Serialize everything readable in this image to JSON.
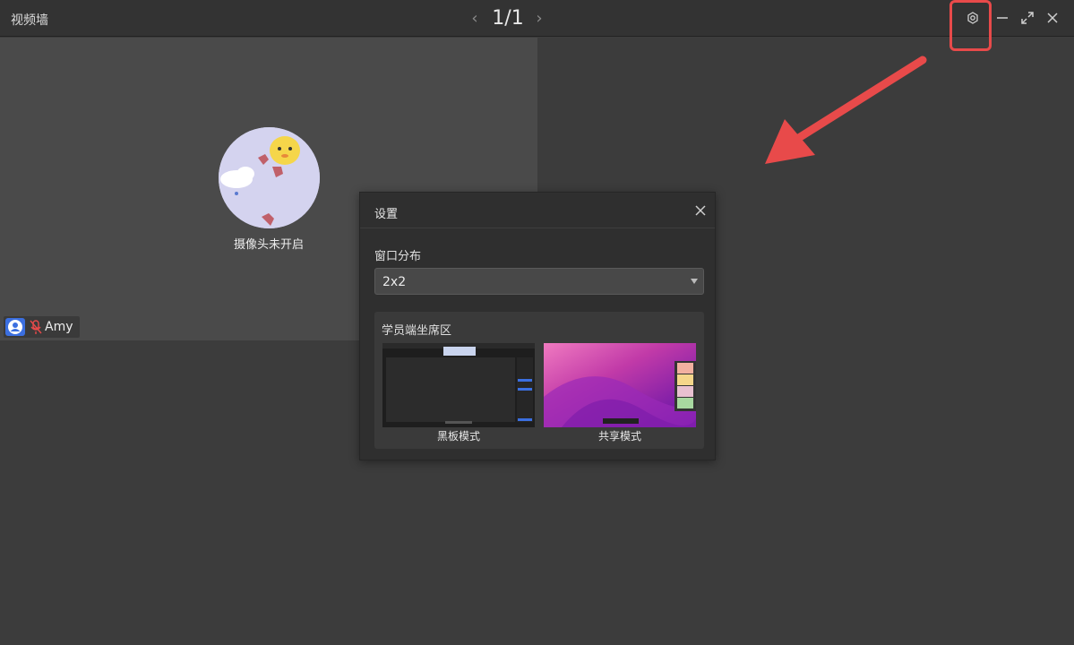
{
  "window": {
    "title": "视频墙",
    "page_indicator": "1/1"
  },
  "toolbar": {
    "icons": [
      "chevron-left-icon",
      "chevron-right-icon",
      "settings-hexagon-icon",
      "minimize-icon",
      "maximize-icon",
      "close-icon"
    ]
  },
  "video_tile": {
    "camera_status": "摄像头未开启",
    "participant_name": "Amy",
    "mic_state": "muted"
  },
  "settings_dialog": {
    "title": "设置",
    "layout_label": "窗口分布",
    "layout_value": "2x2",
    "seat_area_label": "学员端坐席区",
    "modes": [
      {
        "label": "黑板模式"
      },
      {
        "label": "共享模式"
      }
    ]
  },
  "colors": {
    "accent_red": "#e84a4a",
    "user_blue": "#3b6fe0",
    "background": "#3c3c3c"
  }
}
